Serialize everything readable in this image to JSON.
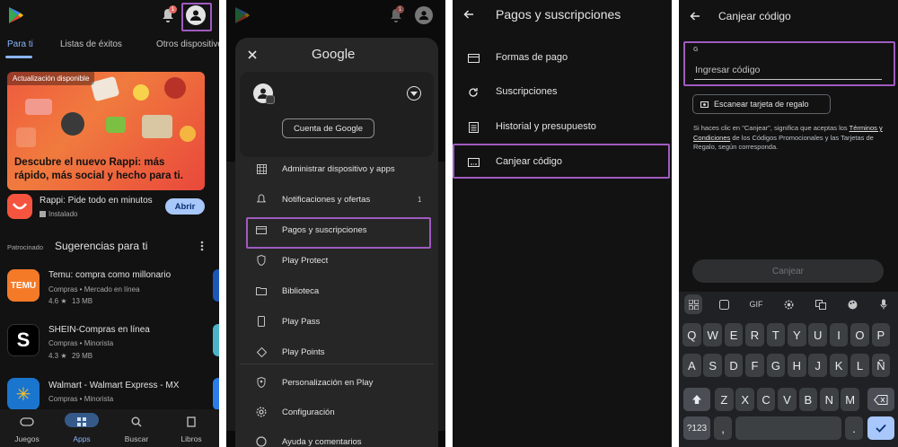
{
  "colors": {
    "accent": "#8ab4f8",
    "highlight": "#a05bbf",
    "banner": "#ef5a3e"
  },
  "panel1": {
    "tabs": [
      "Para ti",
      "Listas de éxitos",
      "Otros dispositivos"
    ],
    "notif_count": "1",
    "banner": {
      "tag": "Actualización disponible",
      "text": "Descubre el nuevo Rappi: más rápido, más social y hecho para ti."
    },
    "featured": {
      "name": "Rappi: Pide todo en minutos",
      "status": "Instalado",
      "button": "Abrir"
    },
    "section": {
      "sponsored": "Patrocinado",
      "title": "Sugerencias para ti"
    },
    "apps": [
      {
        "name": "Temu: compra como millonario",
        "cat": "Compras • Mercado en línea",
        "rating": "4.6 ★",
        "size": "13 MB",
        "icon_text": "TEMU"
      },
      {
        "name": "SHEIN-Compras en línea",
        "cat": "Compras • Minorista",
        "rating": "4.3 ★",
        "size": "29 MB",
        "icon_text": "S"
      },
      {
        "name": "Walmart - Walmart Express - MX",
        "cat": "Compras • Minorista",
        "rating": "",
        "size": "",
        "icon_text": "✳"
      }
    ],
    "nav": [
      "Juegos",
      "Apps",
      "Buscar",
      "Libros"
    ]
  },
  "panel2": {
    "title": "Google",
    "notif_count": "1",
    "account_button": "Cuenta de Google",
    "menu": [
      {
        "label": "Administrar dispositivo y apps",
        "icon": "grid-icon",
        "badge": ""
      },
      {
        "label": "Notificaciones y ofertas",
        "icon": "bell-icon",
        "badge": "1"
      },
      {
        "label": "Pagos y suscripciones",
        "icon": "card-icon",
        "badge": ""
      },
      {
        "label": "Play Protect",
        "icon": "shield-icon",
        "badge": ""
      },
      {
        "label": "Biblioteca",
        "icon": "folder-icon",
        "badge": ""
      },
      {
        "label": "Play Pass",
        "icon": "ticket-icon",
        "badge": ""
      },
      {
        "label": "Play Points",
        "icon": "diamond-icon",
        "badge": ""
      },
      {
        "label": "Personalización en Play",
        "icon": "shield-person-icon",
        "badge": ""
      },
      {
        "label": "Configuración",
        "icon": "gear-icon",
        "badge": ""
      },
      {
        "label": "Ayuda y comentarios",
        "icon": "help-icon",
        "badge": ""
      }
    ]
  },
  "panel3": {
    "title": "Pagos y suscripciones",
    "menu": [
      {
        "label": "Formas de pago",
        "icon": "card-icon"
      },
      {
        "label": "Suscripciones",
        "icon": "refresh-icon"
      },
      {
        "label": "Historial y presupuesto",
        "icon": "list-icon"
      },
      {
        "label": "Canjear código",
        "icon": "gift-card-icon"
      }
    ]
  },
  "panel4": {
    "title": "Canjear código",
    "input_placeholder": "Ingresar código",
    "scan_button": "Escanear tarjeta de regalo",
    "legal_1": "Si haces clic en \"Canjear\", significa que aceptas los",
    "legal_link": "Términos y Condiciones",
    "legal_2": "de los Códigos Promocionales y las Tarjetas de Regalo, según corresponda.",
    "redeem_button": "Canjear",
    "toolbar_gif": "GIF",
    "keys_row1": [
      "Q",
      "W",
      "E",
      "R",
      "T",
      "Y",
      "U",
      "I",
      "O",
      "P"
    ],
    "keys_row2": [
      "A",
      "S",
      "D",
      "F",
      "G",
      "H",
      "J",
      "K",
      "L",
      "Ñ"
    ],
    "keys_row3": [
      "Z",
      "X",
      "C",
      "V",
      "B",
      "N",
      "M"
    ],
    "key_numbers": "?123",
    "key_comma": ",",
    "key_period": "."
  }
}
